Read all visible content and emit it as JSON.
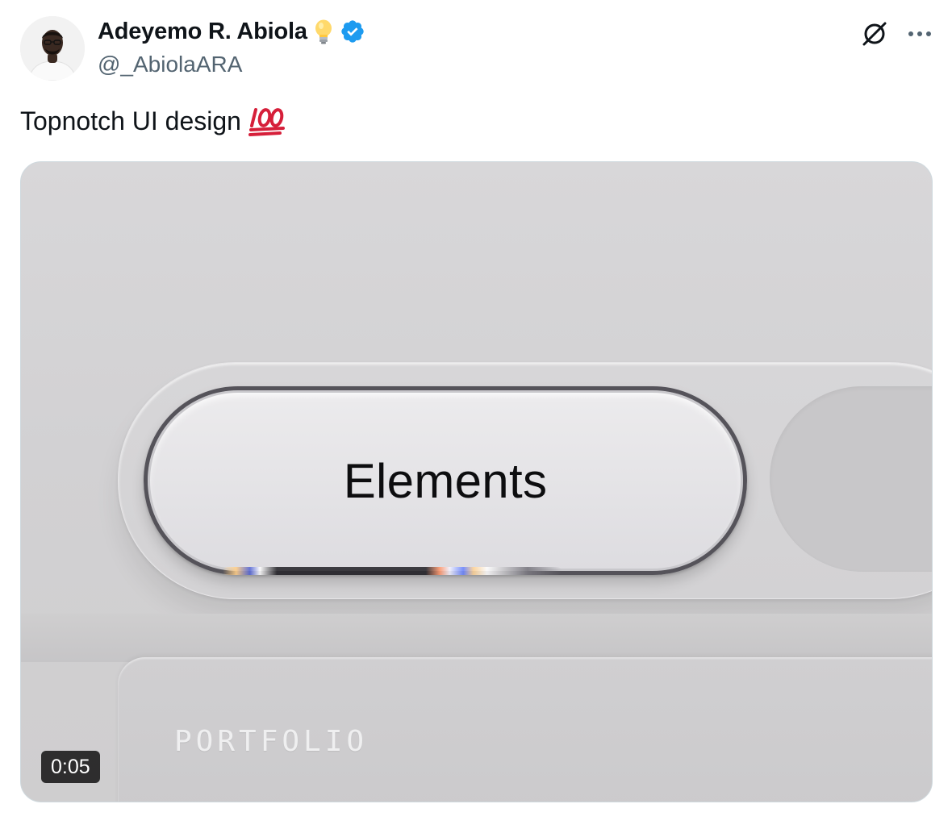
{
  "author": {
    "display_name": "Adeyemo R. Abiola",
    "handle": "@_AbiolaARA",
    "verified": true,
    "emoji_icon": "light-bulb-icon"
  },
  "tweet": {
    "text": "Topnotch UI design",
    "emoji_icon": "hundred-points-icon"
  },
  "actions": {
    "grok_icon": "grok-icon",
    "more_icon": "more-options-icon"
  },
  "media": {
    "type": "video",
    "duration": "0:05",
    "button_label": "Elements",
    "card_label": "PORTFOLIO"
  },
  "colors": {
    "verified_blue": "#1d9bf0",
    "handle_gray": "#536471",
    "hundred_red": "#d61f3a"
  }
}
